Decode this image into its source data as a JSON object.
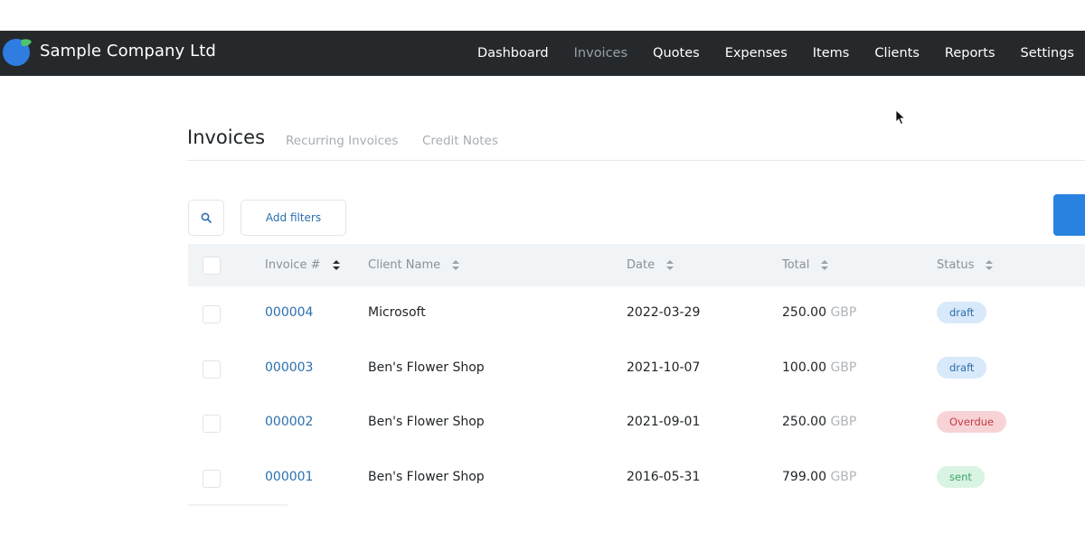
{
  "brand": {
    "name": "Sample Company Ltd"
  },
  "nav": {
    "items": [
      {
        "label": "Dashboard",
        "active": false
      },
      {
        "label": "Invoices",
        "active": true
      },
      {
        "label": "Quotes",
        "active": false
      },
      {
        "label": "Expenses",
        "active": false
      },
      {
        "label": "Items",
        "active": false
      },
      {
        "label": "Clients",
        "active": false
      },
      {
        "label": "Reports",
        "active": false
      },
      {
        "label": "Settings",
        "active": false
      }
    ]
  },
  "page": {
    "title": "Invoices",
    "tabs": [
      "Recurring Invoices",
      "Credit Notes"
    ]
  },
  "toolbar": {
    "search_icon": "search-icon",
    "filters_label": "Add filters"
  },
  "table": {
    "columns": [
      "Invoice #",
      "Client Name",
      "Date",
      "Total",
      "Status"
    ],
    "rows": [
      {
        "invoice": "000004",
        "client": "Microsoft",
        "date": "2022-03-29",
        "amount": "250.00",
        "currency": "GBP",
        "status": "draft"
      },
      {
        "invoice": "000003",
        "client": "Ben's Flower Shop",
        "date": "2021-10-07",
        "amount": "100.00",
        "currency": "GBP",
        "status": "draft"
      },
      {
        "invoice": "000002",
        "client": "Ben's Flower Shop",
        "date": "2021-09-01",
        "amount": "250.00",
        "currency": "GBP",
        "status": "Overdue"
      },
      {
        "invoice": "000001",
        "client": "Ben's Flower Shop",
        "date": "2016-05-31",
        "amount": "799.00",
        "currency": "GBP",
        "status": "sent"
      }
    ]
  },
  "colors": {
    "navbar": "#26292c",
    "link": "#2a6fb0",
    "primary": "#2a82e0",
    "draft_bg": "#d7e9fa",
    "overdue_bg": "#f8d3d5",
    "sent_bg": "#d9f4e3"
  }
}
